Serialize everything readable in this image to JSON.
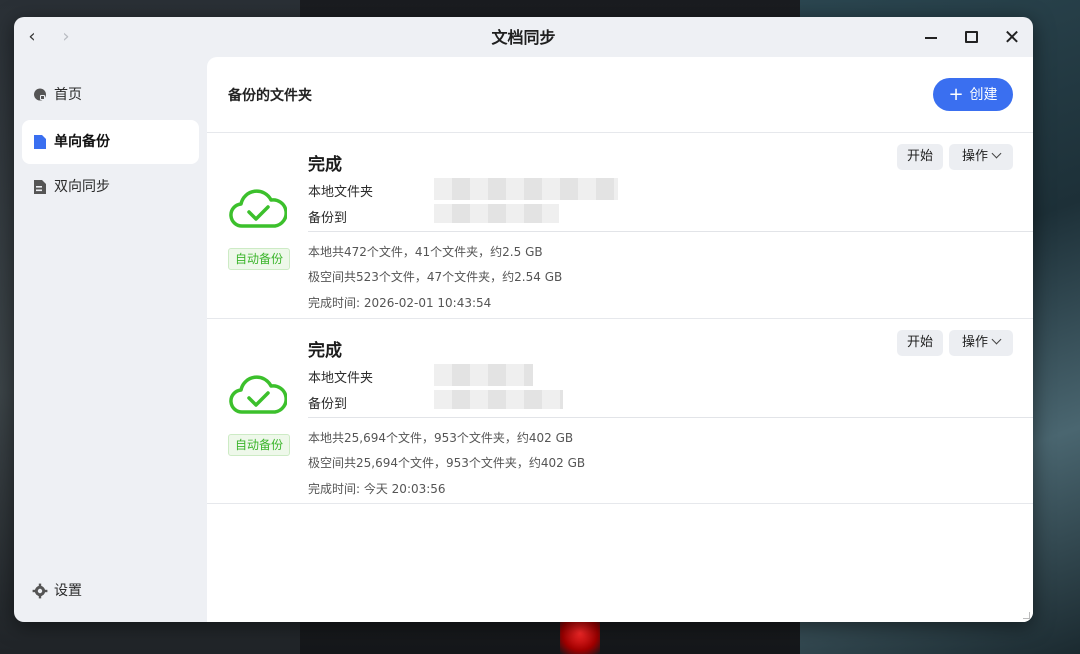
{
  "window": {
    "title": "文档同步"
  },
  "sidebar": {
    "items": [
      {
        "label": "首页",
        "icon": "home-icon"
      },
      {
        "label": "单向备份",
        "icon": "backup-file-icon",
        "active": true
      },
      {
        "label": "双向同步",
        "icon": "sync-file-icon"
      }
    ],
    "settings_label": "设置"
  },
  "main": {
    "title": "备份的文件夹",
    "create_label": "创建",
    "tasks": [
      {
        "status": "完成",
        "local_label": "本地文件夹",
        "target_label": "备份到",
        "badge": "自动备份",
        "local_stats": "本地共472个文件，41个文件夹，约2.5 GB",
        "remote_stats": "极空间共523个文件，47个文件夹，约2.54 GB",
        "finished": "完成时间: 2026-02-01 10:43:54",
        "start_label": "开始",
        "ops_label": "操作"
      },
      {
        "status": "完成",
        "local_label": "本地文件夹",
        "target_label": "备份到",
        "badge": "自动备份",
        "local_stats": "本地共25,694个文件，953个文件夹，约402 GB",
        "remote_stats": "极空间共25,694个文件，953个文件夹，约402 GB",
        "finished": "完成时间: 今天 20:03:56",
        "start_label": "开始",
        "ops_label": "操作"
      }
    ]
  },
  "colors": {
    "accent": "#3a6ff0",
    "success": "#3cb52c"
  }
}
